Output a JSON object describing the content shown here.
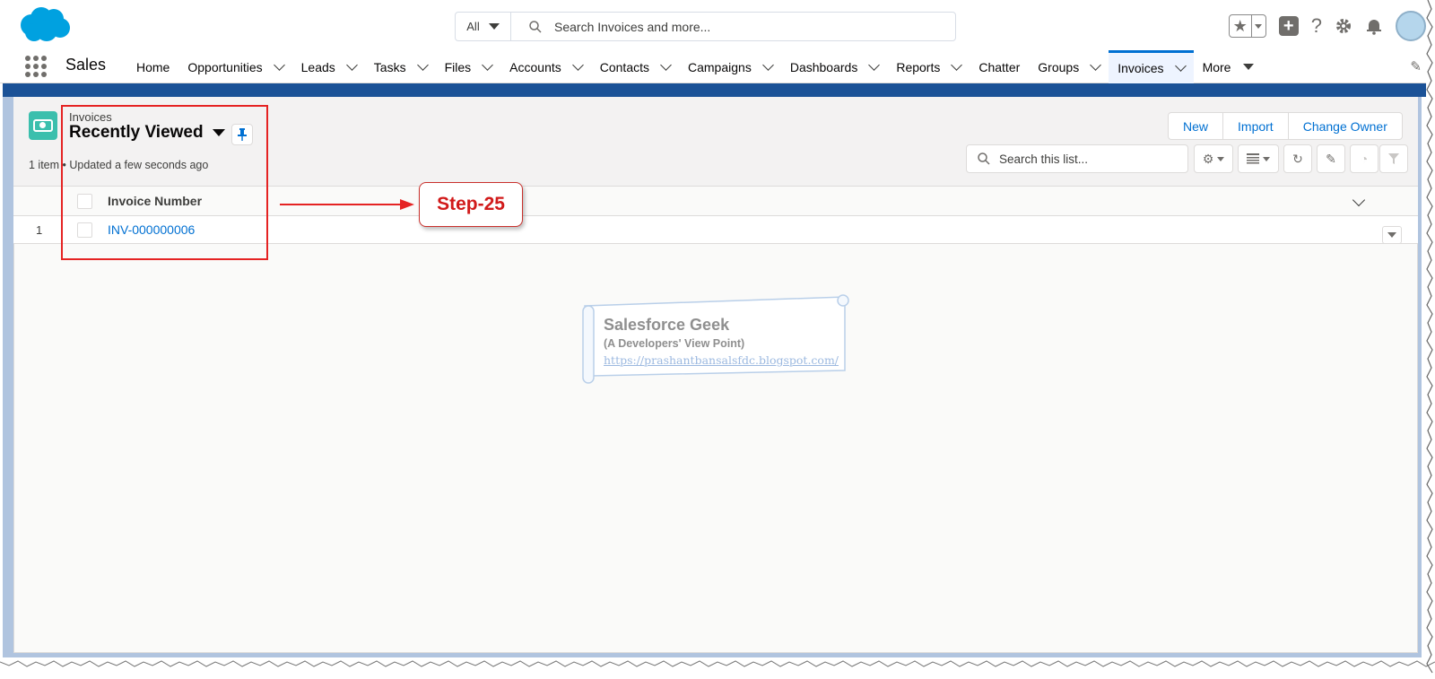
{
  "global_header": {
    "search_scope": "All",
    "search_placeholder": "Search Invoices and more..."
  },
  "nav": {
    "app_name": "Sales",
    "items": [
      {
        "label": "Home",
        "has_menu": false
      },
      {
        "label": "Opportunities",
        "has_menu": true
      },
      {
        "label": "Leads",
        "has_menu": true
      },
      {
        "label": "Tasks",
        "has_menu": true
      },
      {
        "label": "Files",
        "has_menu": true
      },
      {
        "label": "Accounts",
        "has_menu": true
      },
      {
        "label": "Contacts",
        "has_menu": true
      },
      {
        "label": "Campaigns",
        "has_menu": true
      },
      {
        "label": "Dashboards",
        "has_menu": true
      },
      {
        "label": "Reports",
        "has_menu": true
      },
      {
        "label": "Chatter",
        "has_menu": false
      },
      {
        "label": "Groups",
        "has_menu": true
      },
      {
        "label": "Invoices",
        "has_menu": true,
        "active": true
      },
      {
        "label": "More",
        "has_menu": true
      }
    ]
  },
  "list_view": {
    "object_label": "Invoices",
    "view_name": "Recently Viewed",
    "meta": "1 item • Updated a few seconds ago",
    "buttons": [
      "New",
      "Import",
      "Change Owner"
    ],
    "search_placeholder": "Search this list...",
    "columns": [
      "Invoice Number"
    ],
    "rows": [
      {
        "num": "1",
        "invoice_number": "INV-000000006"
      }
    ]
  },
  "annotation": {
    "step_label": "Step-25"
  },
  "watermark": {
    "title": "Salesforce Geek",
    "subtitle": "(A Developers' View Point)",
    "url": "https://prashantbansalsfdc.blogspot.com/"
  },
  "colors": {
    "brand_blue": "#0070d2",
    "band_blue": "#1b5297",
    "object_icon": "#3bbfad",
    "annotation_red": "#e52323"
  },
  "icons": {
    "logo": "salesforce-cloud-logo",
    "header": [
      "star-icon",
      "chevron-down-icon",
      "plus-icon",
      "help-icon",
      "gear-icon",
      "bell-icon",
      "avatar"
    ],
    "toolbar": [
      "gear-icon",
      "table-icon",
      "refresh-icon",
      "pencil-icon",
      "chart-icon",
      "filter-icon"
    ]
  }
}
